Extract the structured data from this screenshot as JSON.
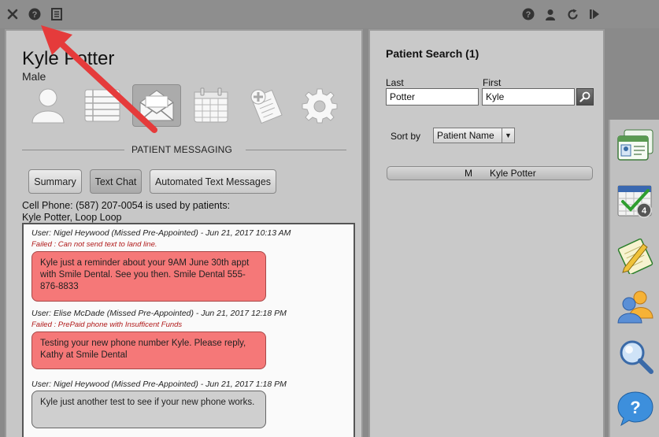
{
  "toolbar": {
    "left_icons": [
      "close-icon",
      "help-icon",
      "document-icon"
    ],
    "right_icons": [
      "help-icon",
      "user-icon",
      "refresh-icon",
      "next-icon"
    ]
  },
  "patient": {
    "name": "Kyle Potter",
    "gender": "Male"
  },
  "tabs": [
    "person-icon",
    "list-icon",
    "envelope-icon",
    "calendar-icon",
    "medical-forms-icon",
    "settings-icon"
  ],
  "messaging": {
    "title": "PATIENT MESSAGING",
    "buttons": {
      "summary": "Summary",
      "text_chat": "Text Chat",
      "automated": "Automated Text Messages"
    },
    "cell_phone_line": "Cell Phone: (587) 207-0054 is used by patients:",
    "patients_line": "Kyle Potter, Loop Loop",
    "messages": [
      {
        "meta": "User: Nigel Heywood (Missed Pre-Appointed) - Jun 21, 2017 10:13 AM",
        "status": "Failed : Can not send text to land line.",
        "text": "Kyle just a reminder about your 9AM June 30th appt with Smile Dental. See you then. Smile Dental 555-876-8833"
      },
      {
        "meta": "User: Elise McDade (Missed Pre-Appointed) - Jun 21, 2017 12:18 PM",
        "status": "Failed : PrePaid phone with Insufficent Funds",
        "text": "Testing your new phone number Kyle. Please reply, Kathy at Smile Dental"
      },
      {
        "meta": "User: Nigel Heywood (Missed Pre-Appointed) - Jun 21, 2017 1:18 PM",
        "status": "",
        "text": "Kyle just another test to see if your new phone works."
      }
    ]
  },
  "search": {
    "title": "Patient Search (1)",
    "last_label": "Last",
    "first_label": "First",
    "last_value": "Potter",
    "first_value": "Kyle",
    "sort_label": "Sort by",
    "sort_value": "Patient Name",
    "results": [
      {
        "gender": "M",
        "name": "Kyle Potter"
      }
    ]
  },
  "dock": {
    "icons": [
      "patient-card-icon",
      "appointment-calendar-icon",
      "notes-icon",
      "contacts-icon",
      "search-icon",
      "help-bubble-icon"
    ],
    "calendar_badge": "4",
    "help_glyph": "?"
  },
  "colors": {
    "failed_bubble": "#f57878",
    "failed_text": "#b01818",
    "arrow": "#e53b3b"
  }
}
